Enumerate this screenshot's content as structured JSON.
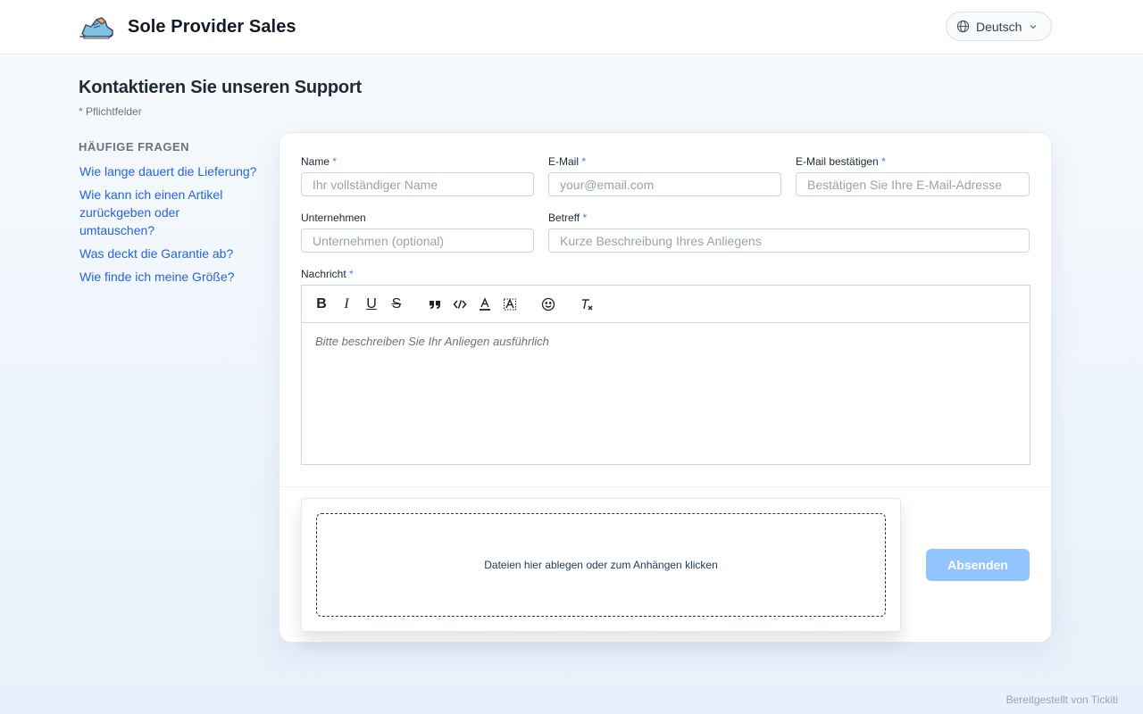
{
  "header": {
    "brand_name": "Sole Provider Sales",
    "logo_icon": "sneaker-logo-icon",
    "language": {
      "label": "Deutsch",
      "icon": "globe-icon",
      "chevron": "chevron-down-icon"
    }
  },
  "page": {
    "title": "Kontaktieren Sie unseren Support",
    "required_star": "*",
    "required_note": "Pflichtfelder"
  },
  "faq": {
    "heading": "HÄUFIGE FRAGEN",
    "items": [
      "Wie lange dauert die Lieferung?",
      "Wie kann ich einen Artikel zurückgeben oder umtauschen?",
      "Was deckt die Garantie ab?",
      "Wie finde ich meine Größe?"
    ]
  },
  "form": {
    "required_star": "*",
    "name": {
      "label": "Name",
      "placeholder": "Ihr vollständiger Name",
      "value": ""
    },
    "email": {
      "label": "E-Mail",
      "placeholder": "your@email.com",
      "value": ""
    },
    "email_confirm": {
      "label": "E-Mail bestätigen",
      "placeholder": "Bestätigen Sie Ihre E-Mail-Adresse",
      "value": ""
    },
    "company": {
      "label": "Unternehmen",
      "placeholder": "Unternehmen (optional)",
      "value": ""
    },
    "subject": {
      "label": "Betreff",
      "placeholder": "Kurze Beschreibung Ihres Anliegens",
      "value": ""
    },
    "message": {
      "label": "Nachricht",
      "placeholder": "Bitte beschreiben Sie Ihr Anliegen ausführlich",
      "toolbar": {
        "bold": "B",
        "italic": "I",
        "underline": "U",
        "strike": "S",
        "quote_icon": "quote-icon",
        "code_icon": "code-icon",
        "text_color_icon": "text-color-icon",
        "highlight_icon": "highlight-icon",
        "emoji_icon": "emoji-icon",
        "clear_format_icon": "clear-format-icon"
      }
    },
    "attachments": {
      "text": "Dateien hier ablegen oder zum Anhängen klicken"
    },
    "submit_label": "Absenden"
  },
  "footer": {
    "credit": "Bereitgestellt von Tickiti"
  },
  "colors": {
    "accent": "#2563eb",
    "submit_disabled": "#93c5fd",
    "required_star": "#3b82f6"
  }
}
